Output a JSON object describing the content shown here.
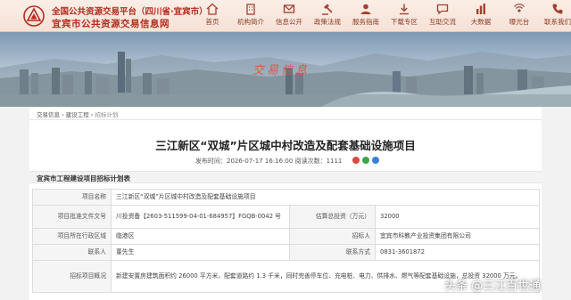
{
  "header": {
    "brand_line1": "全国公共资源交易平台（四川省·宜宾市）",
    "brand_line2": "宜宾市公共资源交易信息网",
    "nav": [
      {
        "label": "首页",
        "icon": "home-icon"
      },
      {
        "label": "机构简介",
        "icon": "building-icon"
      },
      {
        "label": "信息公开",
        "icon": "mail-icon"
      },
      {
        "label": "政策法规",
        "icon": "gavel-icon"
      },
      {
        "label": "服务指南",
        "icon": "user-icon"
      },
      {
        "label": "下载专区",
        "icon": "download-icon"
      },
      {
        "label": "互助交流",
        "icon": "chat-icon"
      },
      {
        "label": "大数据",
        "icon": "chart-icon"
      },
      {
        "label": "曝光台",
        "icon": "broadcast-icon"
      },
      {
        "label": "联系我们",
        "icon": "phone-icon"
      }
    ],
    "accent_color": "#b22d1f"
  },
  "banner": {
    "title": "交易信息"
  },
  "breadcrumb": {
    "items": [
      "交易信息",
      "建设工程"
    ],
    "current": "招标计划"
  },
  "article": {
    "title": "三江新区“双城”片区城中村改造及配套基础设施项目",
    "meta": "发布时间：2026-07-17 16:16:00    阅读次数：1111"
  },
  "section": {
    "title": "宜宾市工程建设项目招标计划表"
  },
  "table": {
    "rows": [
      {
        "k1": "项目名称",
        "v1": "三江新区“双城”片区城中村改造及配套基础设施项目",
        "k2": "",
        "v2": ""
      },
      {
        "k1": "项目批准文件文号",
        "v1": "川投资备【2603-511599-04-01-684957】FGQB-0042 号",
        "k2": "估算总投资（万元）",
        "v2": "32000"
      },
      {
        "k1": "项目所在行政区域",
        "v1": "临港区",
        "k2": "招标人",
        "v2": "宜宾市科教产业投资集团有限公司"
      },
      {
        "k1": "联系人",
        "v1": "董先生",
        "k2": "联系方式",
        "v2": "0831-3601872"
      },
      {
        "k1": "招标项目概况",
        "v1": "新建安置房建筑面积约 26000 平方米，配套道路约 1.3 千米，同时完善停车位、充电桩、电力、供排水、燃气等配套基础设施，总投资 32000 万元。",
        "k2": "",
        "v2": ""
      }
    ]
  },
  "watermark": "头条 @三江百世通"
}
